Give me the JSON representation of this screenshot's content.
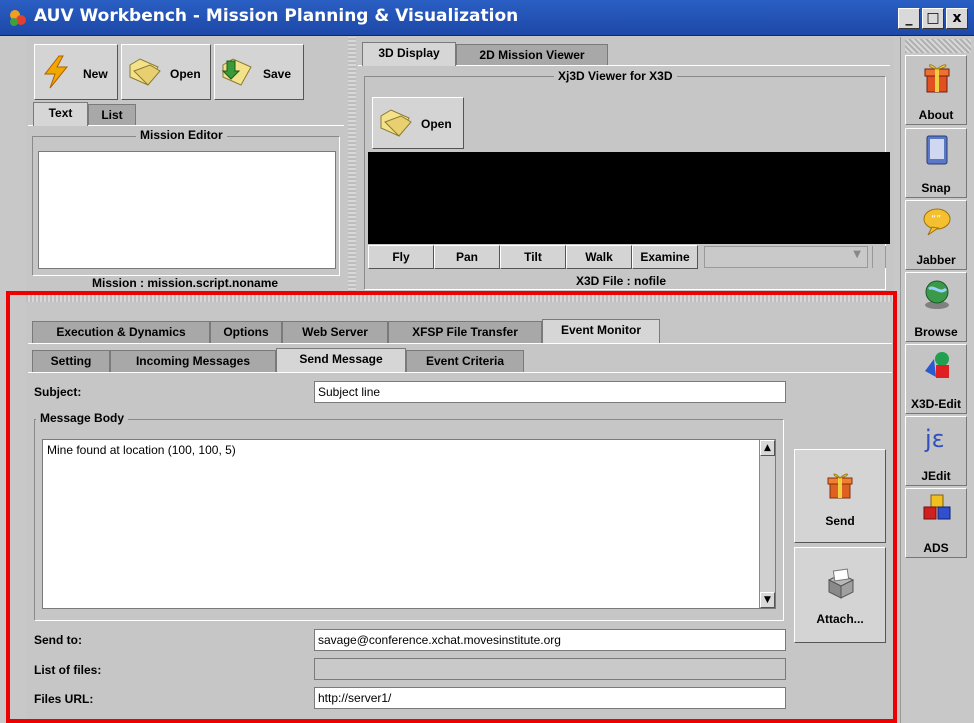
{
  "window": {
    "title": "AUV Workbench - Mission Planning & Visualization",
    "min": "_",
    "max": "□",
    "close": "x"
  },
  "toolbar": {
    "new": "New",
    "open": "Open",
    "save": "Save"
  },
  "editor_tabs": [
    {
      "label": "Text",
      "active": true
    },
    {
      "label": "List",
      "active": false
    }
  ],
  "mission_editor": {
    "title": "Mission Editor",
    "status": "Mission : mission.script.noname"
  },
  "viewer_tabs": [
    {
      "label": "3D Display",
      "active": true
    },
    {
      "label": "2D Mission Viewer",
      "active": false
    }
  ],
  "viewer": {
    "title": "Xj3D Viewer for X3D",
    "open": "Open",
    "nav_buttons": [
      "Fly",
      "Pan",
      "Tilt",
      "Walk",
      "Examine"
    ],
    "file_status": "X3D File : nofile"
  },
  "main_tabs": [
    {
      "label": "Execution & Dynamics",
      "active": false
    },
    {
      "label": "Options",
      "active": false
    },
    {
      "label": "Web Server",
      "active": false
    },
    {
      "label": "XFSP File Transfer",
      "active": false
    },
    {
      "label": "Event Monitor",
      "active": true
    }
  ],
  "sub_tabs": [
    {
      "label": "Setting",
      "active": false
    },
    {
      "label": "Incoming Messages",
      "active": false
    },
    {
      "label": "Send Message",
      "active": true
    },
    {
      "label": "Event Criteria",
      "active": false
    }
  ],
  "form": {
    "subject_label": "Subject:",
    "subject_value": "Subject line",
    "body_title": "Message Body",
    "body_value": "Mine found at location (100, 100, 5)",
    "send_to_label": "Send to:",
    "send_to_value": "savage@conference.xchat.movesinstitute.org",
    "files_label": "List of files:",
    "files_value": "",
    "url_label": "Files URL:",
    "url_value": "http://server1/",
    "send_button": "Send",
    "attach_button": "Attach..."
  },
  "sidebar": [
    {
      "label": "About",
      "icon": "gift-icon"
    },
    {
      "label": "Snap",
      "icon": "notepad-icon"
    },
    {
      "label": "Jabber",
      "icon": "speech-bubble-icon"
    },
    {
      "label": "Browse",
      "icon": "globe-icon"
    },
    {
      "label": "X3D-Edit",
      "icon": "shapes-icon"
    },
    {
      "label": "JEdit",
      "icon": "jedit-icon"
    },
    {
      "label": "ADS",
      "icon": "cubes-icon"
    }
  ]
}
